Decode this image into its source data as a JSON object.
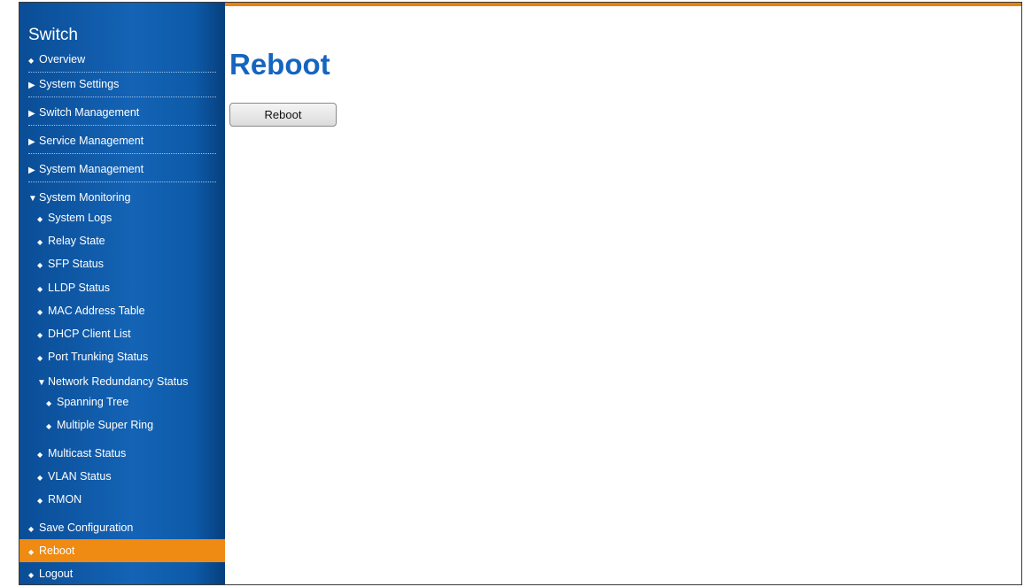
{
  "sidebar": {
    "title": "Switch",
    "items": [
      {
        "label": "Overview",
        "glyph": "◆"
      },
      {
        "label": "System Settings",
        "glyph": "▶"
      },
      {
        "label": "Switch Management",
        "glyph": "▶"
      },
      {
        "label": "Service Management",
        "glyph": "▶"
      },
      {
        "label": "System Management",
        "glyph": "▶"
      },
      {
        "label": "System Monitoring",
        "glyph": "▼"
      },
      {
        "label": "System Logs",
        "glyph": "◆"
      },
      {
        "label": "Relay State",
        "glyph": "◆"
      },
      {
        "label": "SFP Status",
        "glyph": "◆"
      },
      {
        "label": "LLDP Status",
        "glyph": "◆"
      },
      {
        "label": "MAC Address Table",
        "glyph": "◆"
      },
      {
        "label": "DHCP Client List",
        "glyph": "◆"
      },
      {
        "label": "Port Trunking Status",
        "glyph": "◆"
      },
      {
        "label": "Network Redundancy Status",
        "glyph": "▼"
      },
      {
        "label": "Spanning Tree",
        "glyph": "◆"
      },
      {
        "label": "Multiple Super Ring",
        "glyph": "◆"
      },
      {
        "label": "Multicast Status",
        "glyph": "◆"
      },
      {
        "label": "VLAN Status",
        "glyph": "◆"
      },
      {
        "label": "RMON",
        "glyph": "◆"
      },
      {
        "label": "Save Configuration",
        "glyph": "◆"
      },
      {
        "label": "Reboot",
        "glyph": "◆"
      },
      {
        "label": "Logout",
        "glyph": "◆"
      }
    ]
  },
  "main": {
    "title": "Reboot",
    "reboot_button_label": "Reboot"
  },
  "colors": {
    "accent": "#e8820c",
    "active_item": "#ef8a12",
    "title_blue": "#1565c0",
    "sidebar_blue": "#1463b5"
  }
}
